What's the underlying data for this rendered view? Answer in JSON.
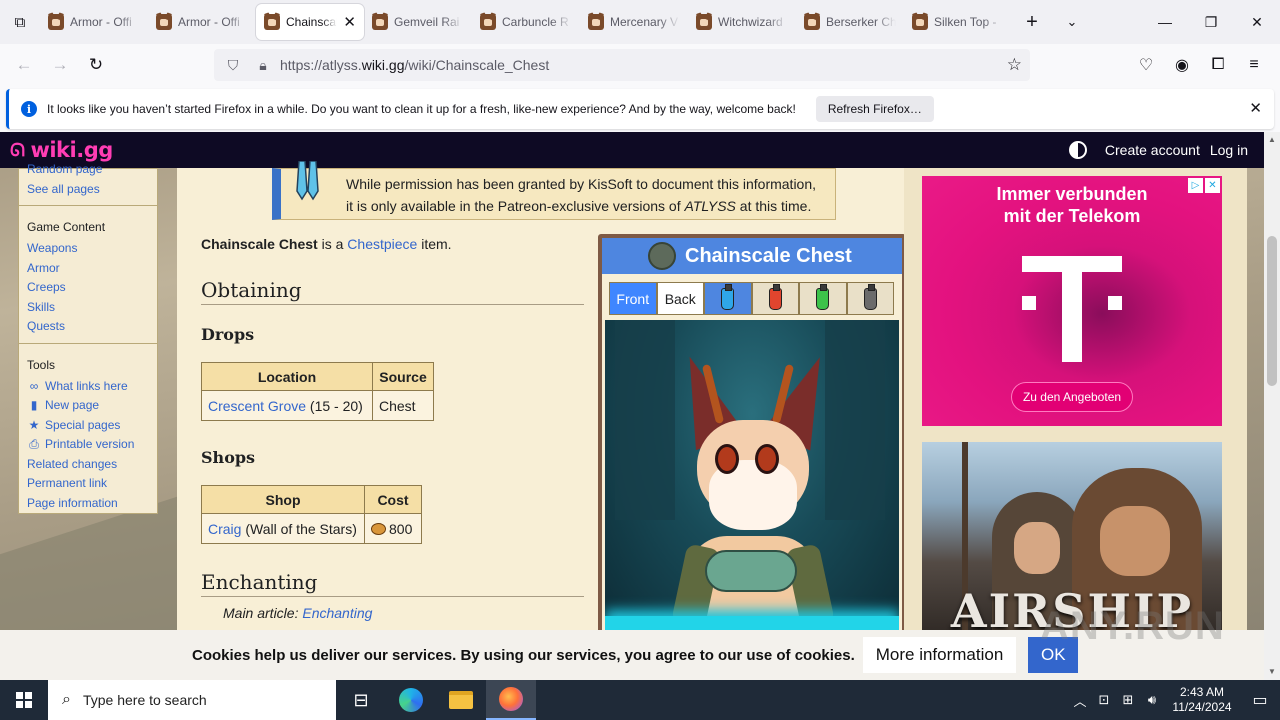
{
  "browser": {
    "tabs": [
      {
        "title": "Armor - Offi",
        "active": false
      },
      {
        "title": "Armor - Offi",
        "active": false
      },
      {
        "title": "Chainscal",
        "active": true
      },
      {
        "title": "Gemveil Rai",
        "active": false
      },
      {
        "title": "Carbuncle R",
        "active": false
      },
      {
        "title": "Mercenary V",
        "active": false
      },
      {
        "title": "Witchwizard",
        "active": false
      },
      {
        "title": "Berserker Ch",
        "active": false
      },
      {
        "title": "Silken Top -",
        "active": false
      }
    ],
    "url_prefix": "https://atlyss.",
    "url_domain": "wiki.gg",
    "url_suffix": "/wiki/Chainscale_Chest",
    "notification": {
      "text": "It looks like you haven’t started Firefox in a while. Do you want to clean it up for a fresh, like-new experience? And by the way, welcome back!",
      "button": "Refresh Firefox…"
    }
  },
  "site": {
    "logo": "wiki.gg",
    "create_account": "Create account",
    "log_in": "Log in"
  },
  "sidebar": {
    "top_partial": "Random page",
    "see_all": "See all pages",
    "content_heading": "Game Content",
    "content_links": [
      "Weapons",
      "Armor",
      "Creeps",
      "Skills",
      "Quests"
    ],
    "tools_heading": "Tools",
    "tools": [
      {
        "label": "What links here",
        "icon": "link-icon"
      },
      {
        "label": "New page",
        "icon": "new-page-icon"
      },
      {
        "label": "Special pages",
        "icon": "star-icon"
      },
      {
        "label": "Printable version",
        "icon": "printer-icon"
      },
      {
        "label": "Related changes",
        "icon": ""
      },
      {
        "label": "Permanent link",
        "icon": ""
      },
      {
        "label": "Page information",
        "icon": ""
      }
    ]
  },
  "article": {
    "notice_line1": "While permission has been granted by KisSoft to document this information,",
    "notice_line2a": "it is only available in the Patreon-exclusive versions of ",
    "notice_line2b": "ATLYSS",
    "notice_line2c": " at this time.",
    "intro_bold": "Chainscale Chest",
    "intro_mid": " is a ",
    "intro_link": "Chestpiece",
    "intro_end": " item.",
    "h_obtaining": "Obtaining",
    "h_drops": "Drops",
    "drops_headers": [
      "Location",
      "Source"
    ],
    "drops_row": {
      "location_link": "Crescent Grove",
      "location_extra": " (15 - 20)",
      "source": "Chest"
    },
    "h_shops": "Shops",
    "shops_headers": [
      "Shop",
      "Cost"
    ],
    "shops_row": {
      "shop_link": "Craig",
      "shop_extra": " (Wall of the Stars)",
      "cost": "800"
    },
    "h_enchanting": "Enchanting",
    "hatnote_prefix": "Main article: ",
    "hatnote_link": "Enchanting"
  },
  "infobox": {
    "title": "Chainscale Chest",
    "tab_front": "Front",
    "tab_back": "Back",
    "potion_colors": [
      "#2fa6e8",
      "#e0452e",
      "#3cc24a",
      "#6b6b6b"
    ]
  },
  "ads": {
    "ad1_headline1": "Immer verbunden",
    "ad1_headline2": "mit der Telekom",
    "ad1_cta": "Zu den Angeboten",
    "ad2_word": "AIRSHIP"
  },
  "cookie": {
    "text": "Cookies help us deliver our services. By using our services, you agree to our use of cookies.",
    "more": "More information",
    "ok": "OK"
  },
  "watermark": "ANY.RUN",
  "taskbar": {
    "search_placeholder": "Type here to search",
    "time": "2:43 AM",
    "date": "11/24/2024"
  }
}
